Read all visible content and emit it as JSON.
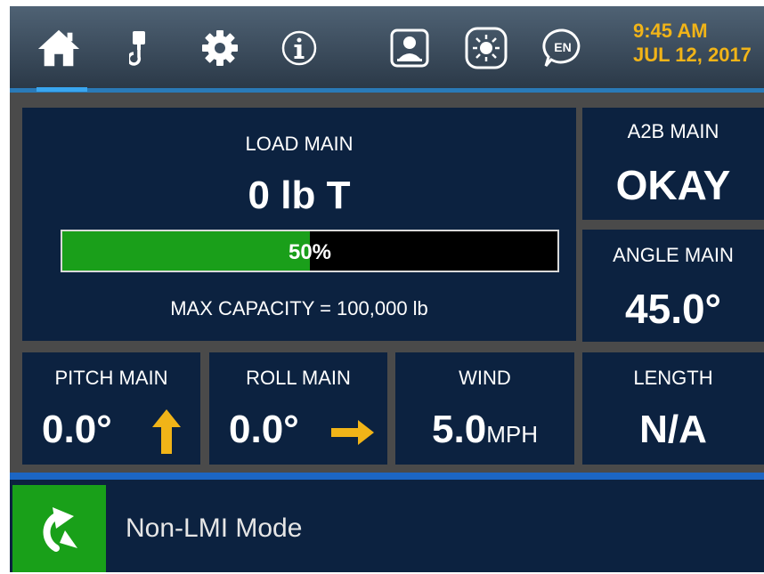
{
  "header": {
    "nav": [
      {
        "name": "home",
        "icon": "home-icon"
      },
      {
        "name": "hook",
        "icon": "crane-hook-icon"
      },
      {
        "name": "settings",
        "icon": "gear-icon"
      },
      {
        "name": "info",
        "icon": "info-icon"
      },
      {
        "name": "operator",
        "icon": "user-badge-icon"
      },
      {
        "name": "brightness",
        "icon": "brightness-icon"
      },
      {
        "name": "language",
        "icon": "language-icon",
        "label": "EN"
      }
    ],
    "time": "9:45 AM",
    "date": "JUL 12, 2017"
  },
  "load": {
    "label": "LOAD MAIN",
    "value": "0 lb T",
    "percent": 50,
    "percent_text": "50%",
    "max_capacity": "MAX CAPACITY = 100,000 lb"
  },
  "a2b": {
    "label": "A2B MAIN",
    "value": "OKAY"
  },
  "angle": {
    "label": "ANGLE MAIN",
    "value": "45.0°"
  },
  "pitch": {
    "label": "PITCH MAIN",
    "value": "0.0°",
    "icon": "arrow-up-icon"
  },
  "roll": {
    "label": "ROLL MAIN",
    "value": "0.0°",
    "icon": "arrow-right-icon"
  },
  "wind": {
    "label": "WIND",
    "value": "5.0",
    "unit": "MPH"
  },
  "length": {
    "label": "LENGTH",
    "value": "N/A"
  },
  "footer": {
    "mode_text": "Non-LMI Mode",
    "mode_icon": "turn-left-arrow-icon"
  },
  "colors": {
    "accent": "#f1b418",
    "panel": "#0c2240",
    "bar_fill": "#1a9f1a",
    "mode_button": "#19a019",
    "active_nav": "#39a6f0"
  }
}
